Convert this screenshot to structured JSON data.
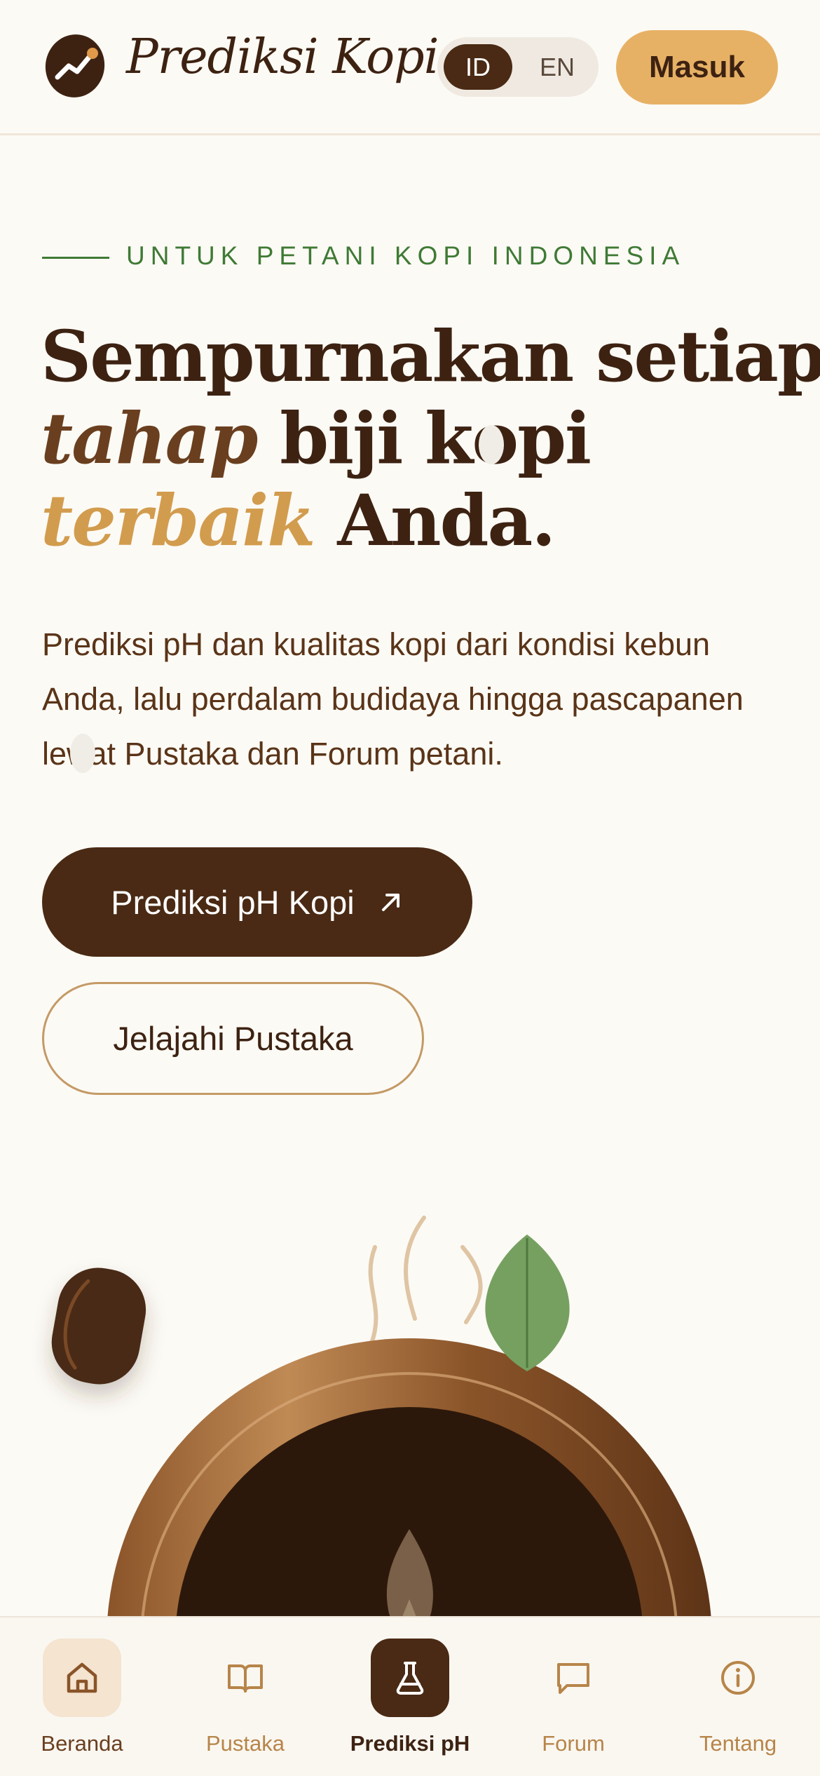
{
  "header": {
    "brand": "Prediksi Kopi",
    "lang_options": [
      "ID",
      "EN"
    ],
    "active_lang": "ID",
    "login_label": "Masuk"
  },
  "hero": {
    "kicker": "UNTUK PETANI KOPI INDONESIA",
    "headline": {
      "line1": "Sempurnakan setiap",
      "line2_italic": "tahap",
      "line2_rest": " biji kopi",
      "line3_script": "terbaik",
      "line3_rest": " Anda."
    },
    "lead": "Prediksi pH dan kualitas kopi dari kondisi kebun Anda, lalu perdalam budidaya hingga pascapanen lewat Pustaka dan Forum petani.",
    "primary_cta": "Prediksi pH Kopi",
    "secondary_cta": "Jelajahi Pustaka"
  },
  "bottom_nav": {
    "items": [
      {
        "label": "Beranda",
        "icon": "home-icon"
      },
      {
        "label": "Pustaka",
        "icon": "book-icon"
      },
      {
        "label": "Prediksi pH",
        "icon": "flask-icon"
      },
      {
        "label": "Forum",
        "icon": "chat-icon"
      },
      {
        "label": "Tentang",
        "icon": "info-icon"
      }
    ],
    "active": "Prediksi pH"
  },
  "colors": {
    "background": "#fcfaf5",
    "primary_brown": "#4a2a14",
    "accent_gold": "#e7b165",
    "kicker_green": "#3f7a35",
    "nav_label": "#b78549"
  }
}
